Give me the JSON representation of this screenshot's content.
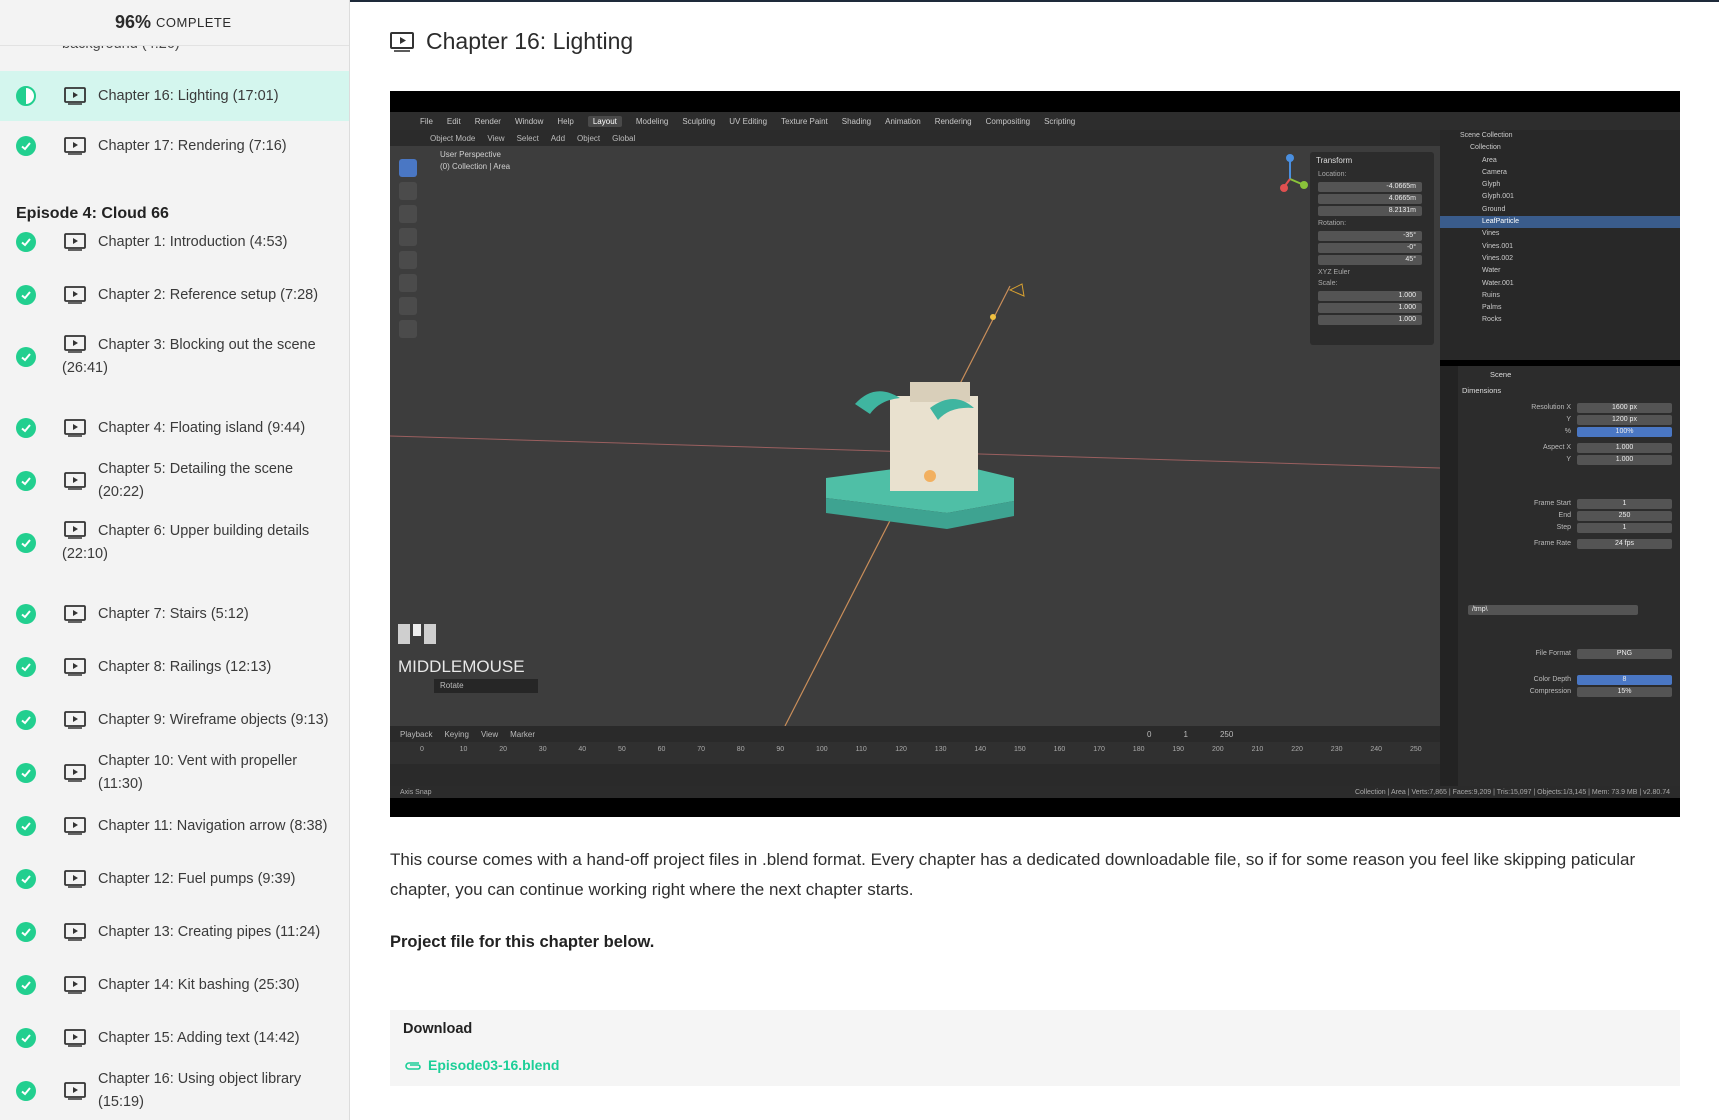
{
  "progress": {
    "percent": "96%",
    "label": "COMPLETE"
  },
  "sidebar": {
    "previous_item_tail": "background (4:26)",
    "active_item": {
      "label": "Chapter 16: Lighting (17:01)",
      "status": "in-progress"
    },
    "items_before_episode": [
      {
        "label": "Chapter 17: Rendering (7:16)",
        "status": "complete"
      }
    ],
    "episode_title": "Episode 4: Cloud 66",
    "episode_items": [
      {
        "label": "Chapter 1: Introduction (4:53)",
        "status": "complete"
      },
      {
        "label": "Chapter 2: Reference setup (7:28)",
        "status": "complete"
      },
      {
        "label": "Chapter 3: Blocking out the scene (26:41)",
        "status": "complete"
      },
      {
        "label": "Chapter 4: Floating island (9:44)",
        "status": "complete"
      },
      {
        "label": "Chapter 5: Detailing the scene (20:22)",
        "status": "complete"
      },
      {
        "label": "Chapter 6: Upper building details (22:10)",
        "status": "complete"
      },
      {
        "label": "Chapter 7: Stairs (5:12)",
        "status": "complete"
      },
      {
        "label": "Chapter 8: Railings (12:13)",
        "status": "complete"
      },
      {
        "label": "Chapter 9: Wireframe objects (9:13)",
        "status": "complete"
      },
      {
        "label": "Chapter 10: Vent with propeller (11:30)",
        "status": "complete"
      },
      {
        "label": "Chapter 11: Navigation arrow (8:38)",
        "status": "complete"
      },
      {
        "label": "Chapter 12: Fuel pumps (9:39)",
        "status": "complete"
      },
      {
        "label": "Chapter 13: Creating pipes (11:24)",
        "status": "complete"
      },
      {
        "label": "Chapter 14: Kit bashing (25:30)",
        "status": "complete"
      },
      {
        "label": "Chapter 15: Adding text (14:42)",
        "status": "complete"
      },
      {
        "label": "Chapter 16: Using object library (15:19)",
        "status": "complete"
      }
    ]
  },
  "main": {
    "title": "Chapter 16: Lighting",
    "description": "This course comes with a hand-off project files in .blend format. Every chapter has a dedicated downloadable file, so if for some reason you feel like skipping paticular chapter, you can continue working right where the next chapter starts.",
    "project_note": "Project file for this chapter below.",
    "download": {
      "heading": "Download",
      "file": "Episode03-16.blend"
    }
  },
  "video": {
    "workspace_tabs": [
      "File",
      "Edit",
      "Render",
      "Window",
      "Help",
      "Layout",
      "Modeling",
      "Sculpting",
      "UV Editing",
      "Texture Paint",
      "Shading",
      "Animation",
      "Rendering",
      "Compositing",
      "Scripting"
    ],
    "active_tab": "Layout",
    "mode_bar": [
      "Object Mode",
      "View",
      "Select",
      "Add",
      "Object",
      "Global"
    ],
    "viewport_label_1": "User Perspective",
    "viewport_label_2": "(0) Collection | Area",
    "overlay_label": "MIDDLEMOUSE",
    "overlay_sub": "Rotate",
    "transform": {
      "title": "Transform",
      "location_label": "Location:",
      "location": [
        "-4.0665m",
        "4.0665m",
        "8.2131m"
      ],
      "rotation_label": "Rotation:",
      "rotation": [
        "-35°",
        "-0°",
        "45°"
      ],
      "mode": "XYZ Euler",
      "scale_label": "Scale:",
      "scale": [
        "1.000",
        "1.000",
        "1.000"
      ]
    },
    "outliner": {
      "root": "Scene Collection",
      "items": [
        "Collection",
        "Area",
        "Camera",
        "Glyph",
        "Glyph.001",
        "Ground",
        "LeafParticle",
        "Vines",
        "Vines.001",
        "Vines.002",
        "Water",
        "Water.001",
        "Ruins",
        "Palms",
        "Rocks"
      ],
      "selected": "LeafParticle"
    },
    "properties": {
      "scene": "Scene",
      "dimensions": "Dimensions",
      "resolution_x": "1600 px",
      "resolution_y": "1200 px",
      "resolution_pct": "100%",
      "aspect_x": "1.000",
      "aspect_y": "1.000",
      "frame_start": "1",
      "frame_end": "250",
      "frame_step": "1",
      "frame_rate": "24 fps",
      "output_path": "/tmp\\",
      "file_format": "PNG",
      "color_depth": "8",
      "compression": "15%"
    },
    "timeline": {
      "menu": [
        "Playback",
        "Keying",
        "View",
        "Marker"
      ],
      "current_frame": "0",
      "start": "1",
      "end": "250",
      "ticks": [
        "0",
        "10",
        "20",
        "30",
        "40",
        "50",
        "60",
        "70",
        "80",
        "90",
        "100",
        "110",
        "120",
        "130",
        "140",
        "150",
        "160",
        "170",
        "180",
        "190",
        "200",
        "210",
        "220",
        "230",
        "240",
        "250"
      ]
    },
    "status_left": "Axis Snap",
    "status_right": "Collection | Area | Verts:7,865 | Faces:9,209 | Tris:15,097 | Objects:1/3,145 | Mem: 73.9 MB | v2.80.74"
  },
  "colors": {
    "accent": "#22cf8f",
    "active_row": "#d4f6ee",
    "link": "#1ccf98"
  }
}
